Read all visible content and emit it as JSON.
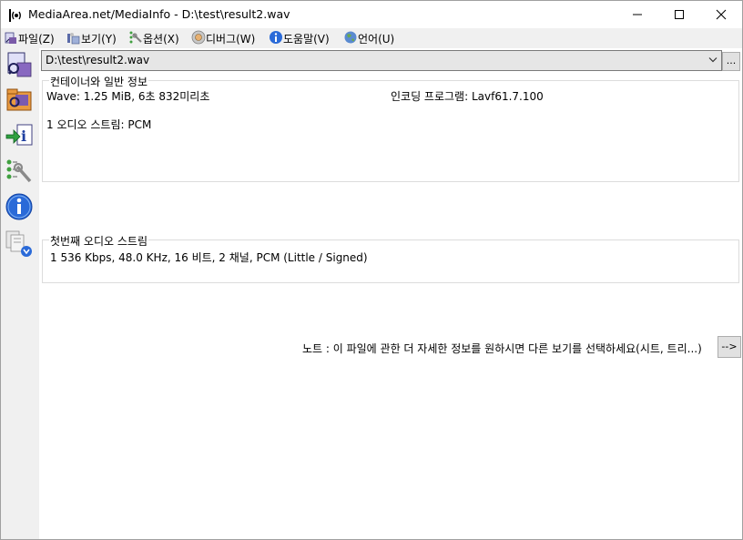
{
  "window": {
    "title": "MediaArea.net/MediaInfo - D:\\test\\result2.wav"
  },
  "menu": [
    {
      "label": "파일(Z)",
      "icon": "file-icon"
    },
    {
      "label": "보기(Y)",
      "icon": "view-icon"
    },
    {
      "label": "옵션(X)",
      "icon": "options-icon"
    },
    {
      "label": "디버그(W)",
      "icon": "debug-icon"
    },
    {
      "label": "도움말(V)",
      "icon": "help-icon"
    },
    {
      "label": "언어(U)",
      "icon": "language-icon"
    }
  ],
  "toolbar": [
    {
      "name": "open-file-icon"
    },
    {
      "name": "open-folder-icon"
    },
    {
      "name": "export-icon"
    },
    {
      "name": "preferences-icon"
    },
    {
      "name": "about-icon"
    },
    {
      "name": "donate-icon"
    }
  ],
  "file_selector": {
    "value": "D:\\test\\result2.wav",
    "more_label": "..."
  },
  "general": {
    "title": "컨테이너와 일반 정보",
    "format_line": "Wave: 1.25 MiB, 6초 832미리초",
    "encoding_line": "인코딩 프로그램: Lavf61.7.100",
    "streams_line": "1 오디오 스트림: PCM"
  },
  "audio": {
    "title": "첫번째 오디오 스트림",
    "details": "1 536 Kbps, 48.0 KHz, 16 비트, 2 채널, PCM (Little / Signed)"
  },
  "note": {
    "text": "노트 : 이 파일에 관한 더 자세한 정보를 원하시면 다른 보기를 선택하세요(시트, 트리...)",
    "button_label": "-->"
  },
  "colors": {
    "title_bg": "#ffffff",
    "chrome_bg": "#f0f0f0",
    "content_bg": "#ffffff",
    "border": "#dcdcdc"
  }
}
